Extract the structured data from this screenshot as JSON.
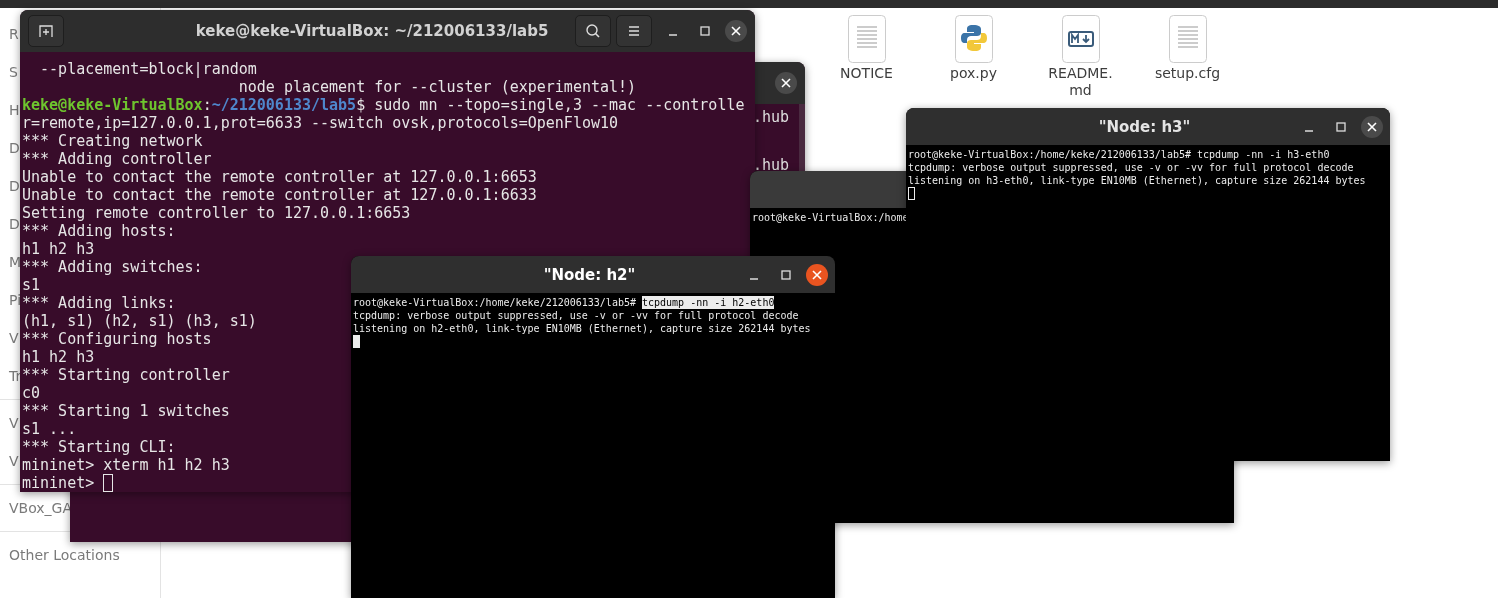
{
  "file_manager": {
    "sidebar_sections": [
      [
        "R",
        "S",
        "H",
        "D",
        "D",
        "D",
        "M",
        "Pi",
        "V",
        "Tr"
      ],
      [
        "V",
        "V"
      ],
      [
        "VBox_GA"
      ],
      [
        "Other Locations"
      ]
    ],
    "files": [
      {
        "kind": "text",
        "name_lines": [
          "NOTICE"
        ]
      },
      {
        "kind": "python",
        "name_lines": [
          "pox.py"
        ]
      },
      {
        "kind": "markdown",
        "name_lines": [
          "README.",
          "md"
        ]
      },
      {
        "kind": "text",
        "name_lines": [
          "setup.cfg"
        ]
      }
    ]
  },
  "back_terminal": {
    "lines": [
      ".hub",
      ".hub"
    ]
  },
  "terminal": {
    "title": "keke@keke-VirtualBox: ~/212006133/lab5",
    "active": false,
    "cursor": true,
    "lines": [
      {
        "kind": "output",
        "text": "  --placement=block|random"
      },
      {
        "kind": "output",
        "text": "                        node placement for --cluster (experimental!)"
      },
      {
        "kind": "prompt",
        "user": "keke@keke-VirtualBox",
        "separator": ":",
        "path": "~/212006133/lab5",
        "command": "$ sudo mn --topo=single,3 --mac --controller=remote,ip=127.0.0.1,prot=6633 --switch ovsk,protocols=OpenFlow10"
      },
      {
        "kind": "output",
        "text": "*** Creating network"
      },
      {
        "kind": "output",
        "text": "*** Adding controller"
      },
      {
        "kind": "output",
        "text": "Unable to contact the remote controller at 127.0.0.1:6653"
      },
      {
        "kind": "output",
        "text": "Unable to contact the remote controller at 127.0.0.1:6633"
      },
      {
        "kind": "output",
        "text": "Setting remote controller to 127.0.0.1:6653"
      },
      {
        "kind": "output",
        "text": "*** Adding hosts:"
      },
      {
        "kind": "output",
        "text": "h1 h2 h3"
      },
      {
        "kind": "output",
        "text": "*** Adding switches:"
      },
      {
        "kind": "output",
        "text": "s1"
      },
      {
        "kind": "output",
        "text": "*** Adding links:"
      },
      {
        "kind": "output",
        "text": "(h1, s1) (h2, s1) (h3, s1)"
      },
      {
        "kind": "output",
        "text": "*** Configuring hosts"
      },
      {
        "kind": "output",
        "text": "h1 h2 h3"
      },
      {
        "kind": "output",
        "text": "*** Starting controller"
      },
      {
        "kind": "output",
        "text": "c0"
      },
      {
        "kind": "output",
        "text": "*** Starting 1 switches"
      },
      {
        "kind": "output",
        "text": "s1 ..."
      },
      {
        "kind": "output",
        "text": "*** Starting CLI:"
      },
      {
        "kind": "output",
        "text": "mininet> xterm h1 h2 h3"
      },
      {
        "kind": "output",
        "text": "mininet>"
      }
    ]
  },
  "xterms": [
    {
      "lines": [
        {
          "kind": "output",
          "text": "root@keke-VirtualBox:/home"
        }
      ]
    },
    {
      "title": "\"Node: h3\"",
      "active": false,
      "cursor": true,
      "lines": [
        {
          "kind": "command",
          "prompt": "root@keke-VirtualBox:/home/keke/212006133/lab5#",
          "command": "tcpdump -nn -i h3-eth0",
          "selected": false
        },
        {
          "kind": "output",
          "text": "tcpdump: verbose output suppressed, use -v or -vv for full protocol decode"
        },
        {
          "kind": "output",
          "text": "listening on h3-eth0, link-type EN10MB (Ethernet), capture size 262144 bytes"
        }
      ]
    },
    {
      "title": "\"Node: h2\"",
      "active": true,
      "cursor": true,
      "lines": [
        {
          "kind": "command",
          "prompt": "root@keke-VirtualBox:/home/keke/212006133/lab5#",
          "command": "tcpdump -nn -i h2-eth0",
          "selected": true
        },
        {
          "kind": "output",
          "text": "tcpdump: verbose output suppressed, use -v or -vv for full protocol decode"
        },
        {
          "kind": "output",
          "text": "listening on h2-eth0, link-type EN10MB (Ethernet), capture size 262144 bytes"
        }
      ]
    }
  ]
}
